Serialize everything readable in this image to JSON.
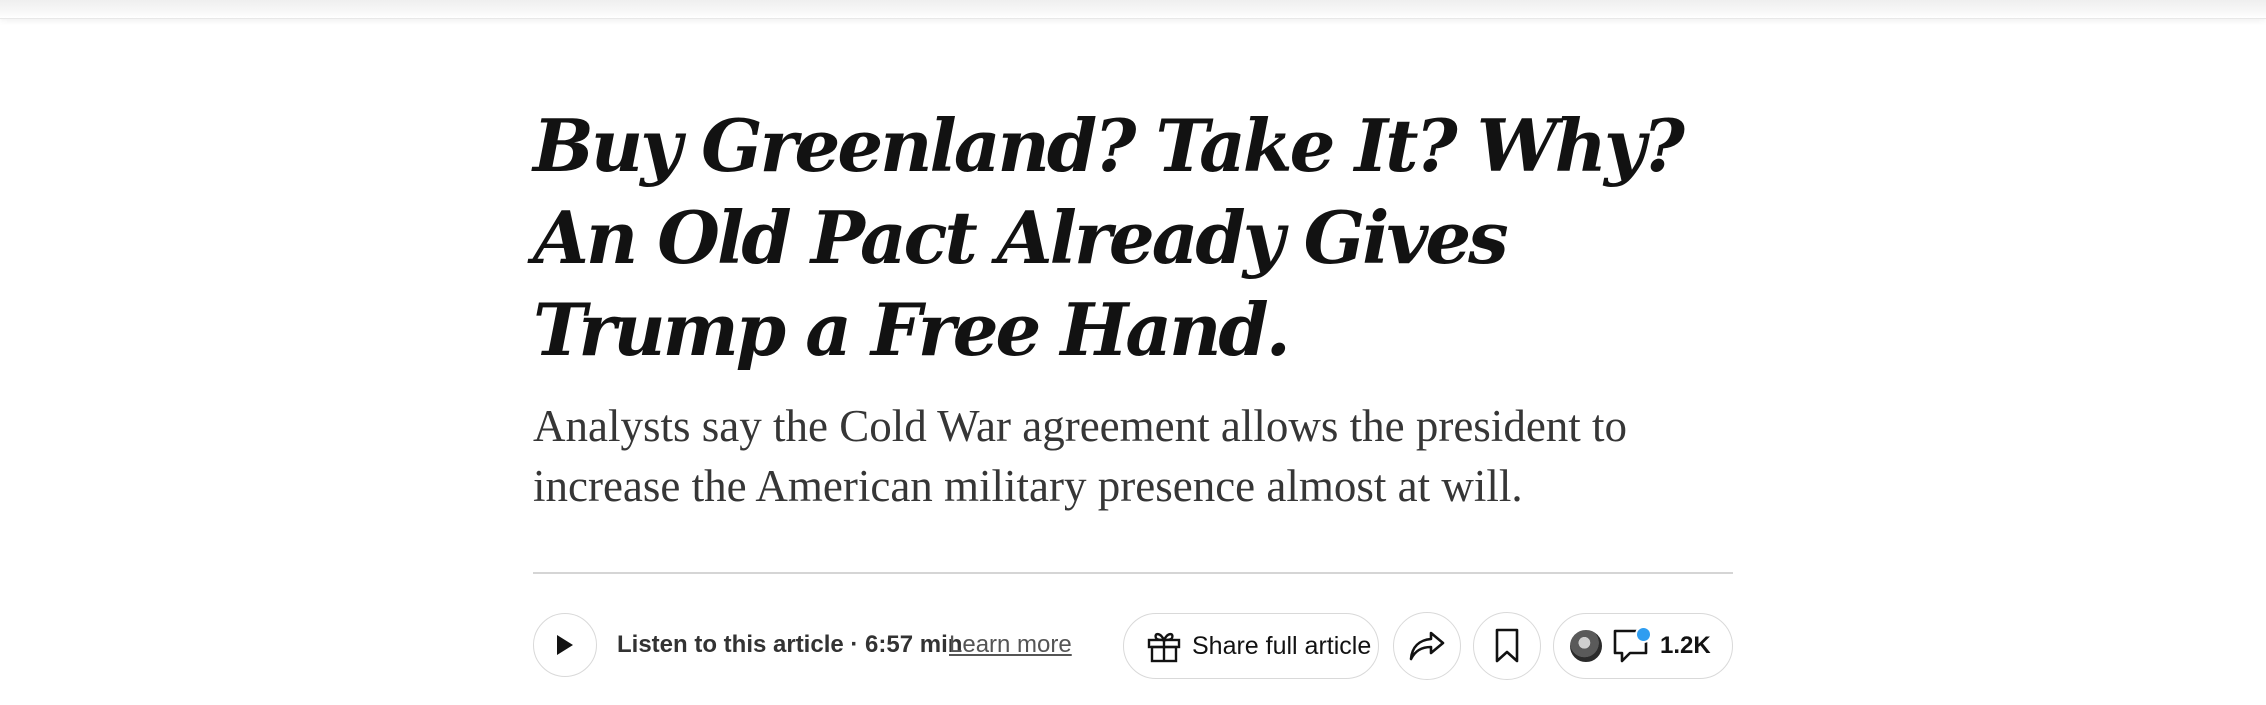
{
  "article": {
    "headline": "Buy Greenland? Take It? Why? An Old Pact Already Gives Trump a Free Hand.",
    "summary": "Analysts say the Cold War agreement allows the president to increase the American military presence almost at will."
  },
  "toolbar": {
    "listen_label": "Listen to this article · 6:57 min",
    "learn_more_label": "Learn more",
    "share_full_label": "Share full article",
    "comment_count": "1.2K",
    "notification_color": "#2f9df0"
  },
  "icons": {
    "play": "play-icon",
    "gift": "gift-icon",
    "share": "share-arrow-icon",
    "bookmark": "bookmark-icon",
    "comment": "comment-icon"
  }
}
